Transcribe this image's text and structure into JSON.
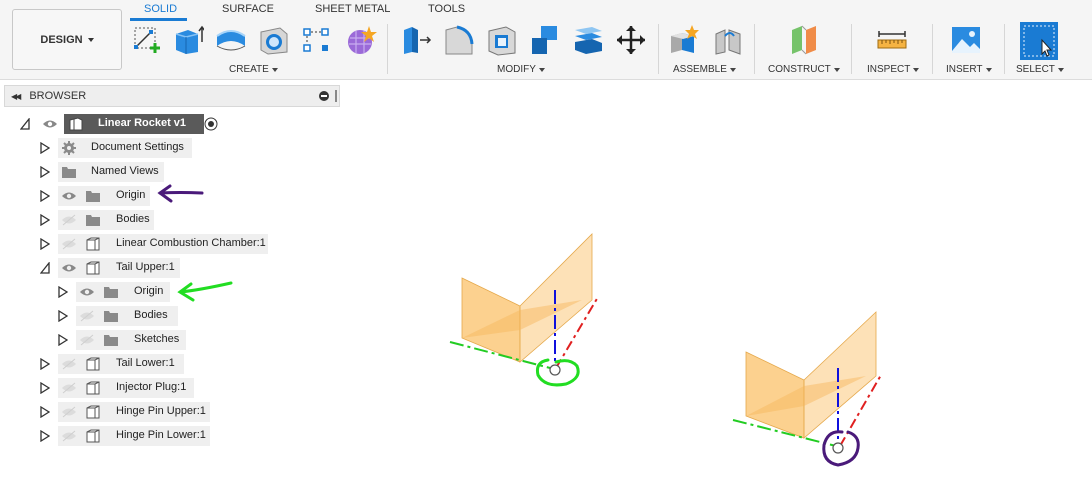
{
  "toolbar": {
    "design_label": "DESIGN",
    "tabs": [
      {
        "label": "SOLID",
        "active": true
      },
      {
        "label": "SURFACE",
        "active": false
      },
      {
        "label": "SHEET METAL",
        "active": false
      },
      {
        "label": "TOOLS",
        "active": false
      }
    ],
    "groups": {
      "create": "CREATE",
      "modify": "MODIFY",
      "assemble": "ASSEMBLE",
      "construct": "CONSTRUCT",
      "inspect": "INSPECT",
      "insert": "INSERT",
      "select": "SELECT"
    }
  },
  "browser": {
    "title": "BROWSER",
    "items": [
      {
        "label": "Linear Rocket v1",
        "expanded": true,
        "icon": "component-icon"
      },
      {
        "label": "Document Settings",
        "expanded": false,
        "icon": "gear-icon"
      },
      {
        "label": "Named Views",
        "expanded": false,
        "icon": "folder-icon"
      },
      {
        "label": "Origin",
        "expanded": false,
        "icon": "folder-icon",
        "visible": true
      },
      {
        "label": "Bodies",
        "expanded": false,
        "icon": "folder-icon",
        "visible": false
      },
      {
        "label": "Linear Combustion Chamber:1",
        "expanded": false,
        "icon": "body-icon",
        "visible": false
      },
      {
        "label": "Tail Upper:1",
        "expanded": true,
        "icon": "body-icon",
        "visible": true
      },
      {
        "label": "Origin",
        "expanded": false,
        "icon": "folder-icon",
        "visible": true
      },
      {
        "label": "Bodies",
        "expanded": false,
        "icon": "folder-icon",
        "visible": false
      },
      {
        "label": "Sketches",
        "expanded": false,
        "icon": "folder-icon",
        "visible": false
      },
      {
        "label": "Tail Lower:1",
        "expanded": false,
        "icon": "body-icon",
        "visible": false
      },
      {
        "label": "Injector Plug:1",
        "expanded": false,
        "icon": "body-icon",
        "visible": false
      },
      {
        "label": "Hinge Pin Upper:1",
        "expanded": false,
        "icon": "body-icon",
        "visible": false
      },
      {
        "label": "Hinge Pin Lower:1",
        "expanded": false,
        "icon": "body-icon",
        "visible": false
      }
    ]
  },
  "colors": {
    "accent": "#1a7bd3",
    "plane_fill": "#fbc97b",
    "axis_x": "#e02020",
    "axis_y": "#22cc22",
    "axis_z": "#1010dd",
    "annotation_green": "#22dd22",
    "annotation_purple": "#4a1a7a"
  }
}
